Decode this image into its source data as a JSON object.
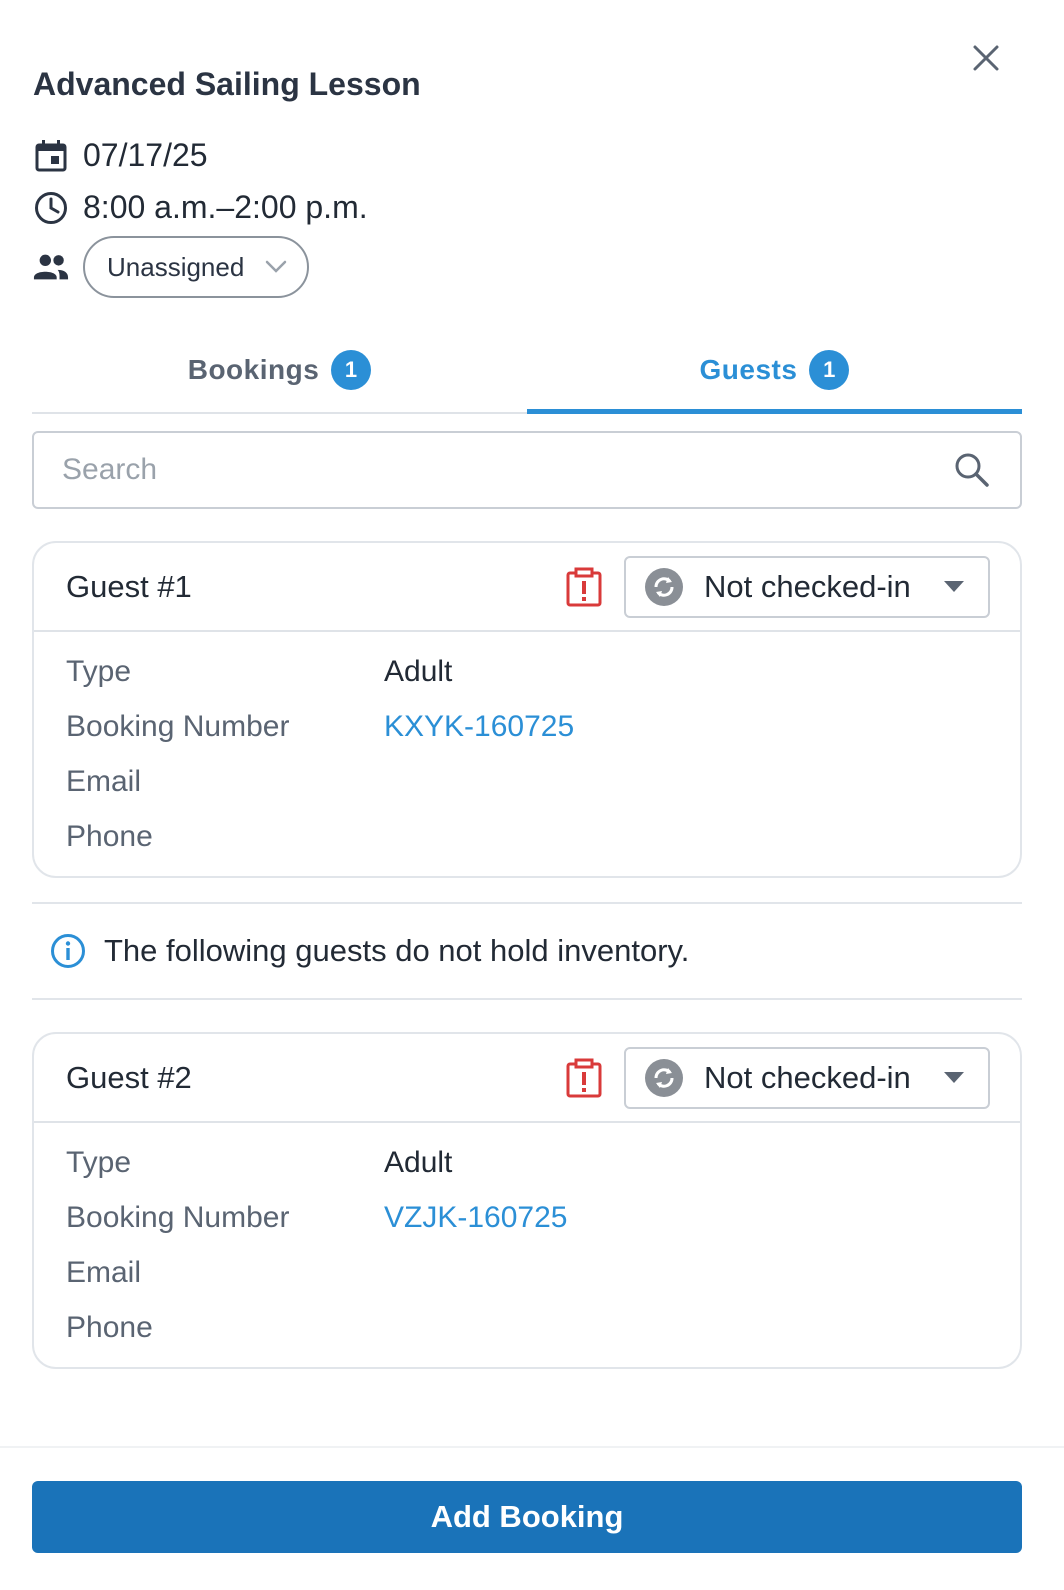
{
  "title": "Advanced Sailing Lesson",
  "meta": {
    "date": "07/17/25",
    "time": "8:00 a.m.–2:00 p.m.",
    "assignee": "Unassigned"
  },
  "tabs": [
    {
      "label": "Bookings",
      "count": "1",
      "active": false
    },
    {
      "label": "Guests",
      "count": "1",
      "active": true
    }
  ],
  "search": {
    "placeholder": "Search",
    "value": ""
  },
  "guests": [
    {
      "name": "Guest #1",
      "status": "Not checked-in",
      "fields": {
        "type_label": "Type",
        "type_value": "Adult",
        "booking_label": "Booking Number",
        "booking_value": "KXYK-160725",
        "email_label": "Email",
        "email_value": "",
        "phone_label": "Phone",
        "phone_value": ""
      }
    },
    {
      "name": "Guest #2",
      "status": "Not checked-in",
      "fields": {
        "type_label": "Type",
        "type_value": "Adult",
        "booking_label": "Booking Number",
        "booking_value": "VZJK-160725",
        "email_label": "Email",
        "email_value": "",
        "phone_label": "Phone",
        "phone_value": ""
      }
    }
  ],
  "info_message": "The following guests do not hold inventory.",
  "footer": {
    "add_booking_label": "Add Booking"
  },
  "colors": {
    "accent": "#2b8fd6",
    "primary_button": "#1a73b9",
    "alert": "#d93a3a",
    "sync_icon": "#8a8f96"
  },
  "icons": [
    "close-icon",
    "calendar-icon",
    "clock-icon",
    "people-icon",
    "chevron-down-icon",
    "search-icon",
    "alert-icon",
    "sync-icon",
    "caret-down-icon",
    "info-icon"
  ]
}
